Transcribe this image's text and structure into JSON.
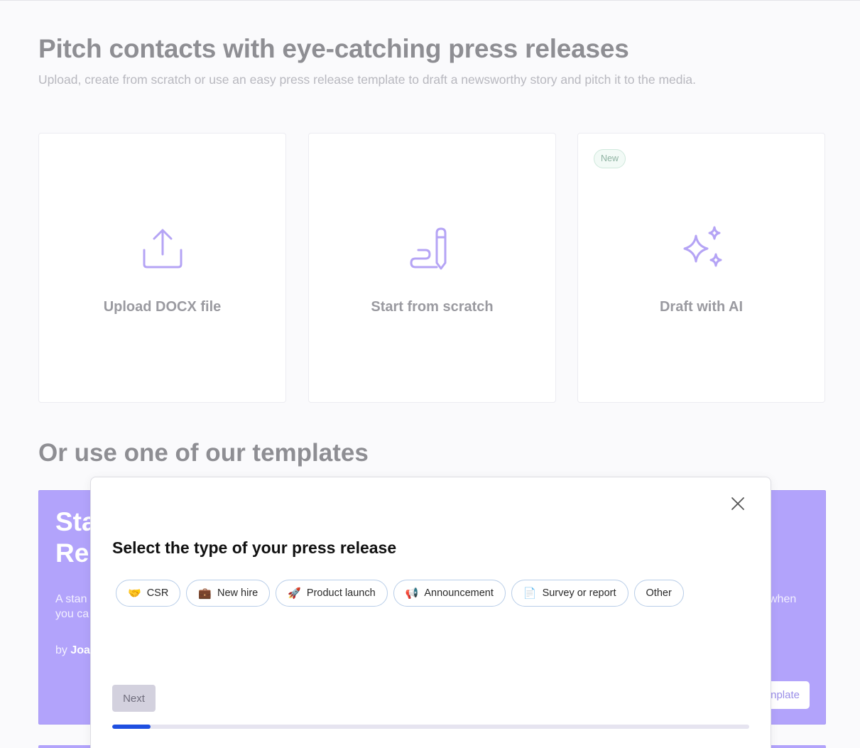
{
  "hero": {
    "title": "Pitch contacts with eye-catching press releases",
    "subtitle": "Upload, create from scratch or use an easy press release template to draft a newsworthy story and pitch it to the media."
  },
  "cards": [
    {
      "label": "Upload DOCX file",
      "icon": "upload-icon"
    },
    {
      "label": "Start from scratch",
      "icon": "pen-icon"
    },
    {
      "label": "Draft with AI",
      "icon": "sparkles-icon",
      "badge": "New"
    }
  ],
  "templates": {
    "section_title": "Or use one of our templates",
    "banner": {
      "title_line1": "Sta",
      "title_line2": "Rel",
      "desc_left": "A stan",
      "desc_left2": "you ca",
      "desc_right": "when",
      "author_prefix": "by",
      "author_name": "Joa",
      "button_label": "nplate"
    }
  },
  "modal": {
    "title": "Select the type of your press release",
    "chips": [
      {
        "emoji": "🤝",
        "label": "CSR"
      },
      {
        "emoji": "💼",
        "label": "New hire"
      },
      {
        "emoji": "🚀",
        "label": "Product launch"
      },
      {
        "emoji": "📢",
        "label": "Announcement"
      },
      {
        "emoji": "📄",
        "label": "Survey or report"
      },
      {
        "emoji": "",
        "label": "Other"
      }
    ],
    "next_label": "Next",
    "progress_fraction": 0.06
  },
  "colors": {
    "accent": "#b2a3fb",
    "icon_purple": "#b5a4f5",
    "progress_blue": "#1f4fe0"
  }
}
